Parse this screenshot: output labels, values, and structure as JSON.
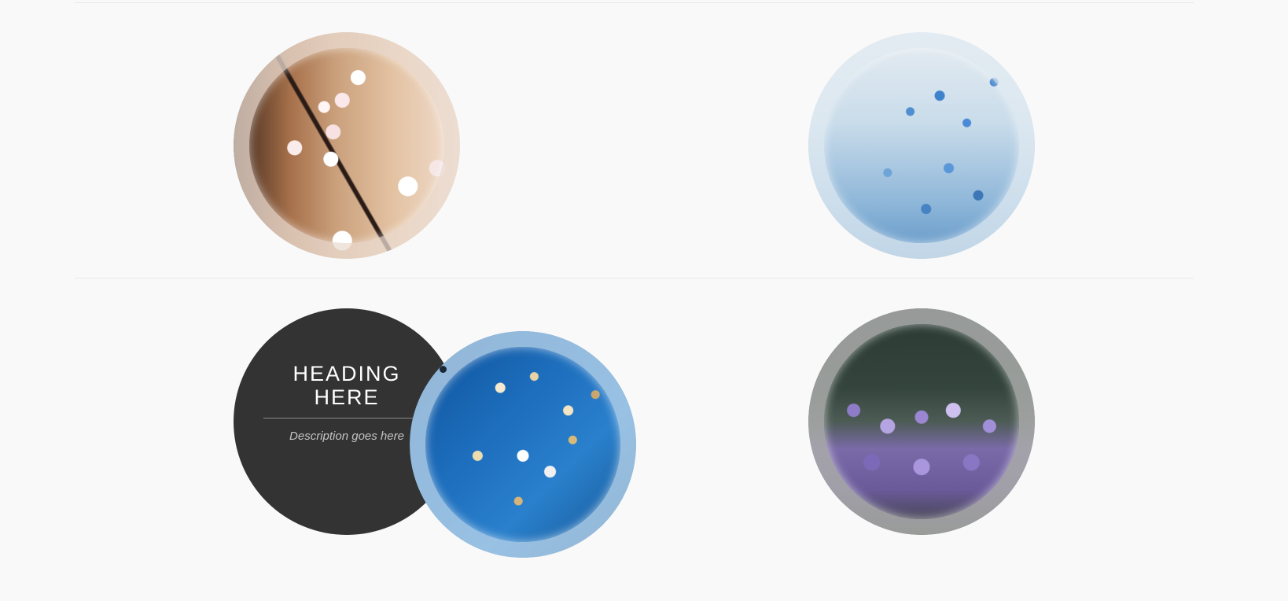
{
  "gallery": {
    "items": [
      {
        "id": "blossom",
        "alt": "Cherry blossom branch",
        "accent": "#e3c2a2"
      },
      {
        "id": "blue-flowers",
        "alt": "Blue forget-me-not flowers",
        "accent": "#8fb7d9"
      },
      {
        "id": "bokeh-branches",
        "alt": "Branches against blue sky",
        "accent": "#1d6ebd",
        "caption": {
          "heading": "Heading here",
          "description": "Description goes here"
        }
      },
      {
        "id": "purple-flowers",
        "alt": "Purple flowers",
        "accent": "#9b86d2"
      }
    ]
  },
  "colors": {
    "background": "#f9f9f9",
    "caption_background": "#333333",
    "caption_heading": "#ffffff",
    "caption_description": "#c4c4c4"
  }
}
